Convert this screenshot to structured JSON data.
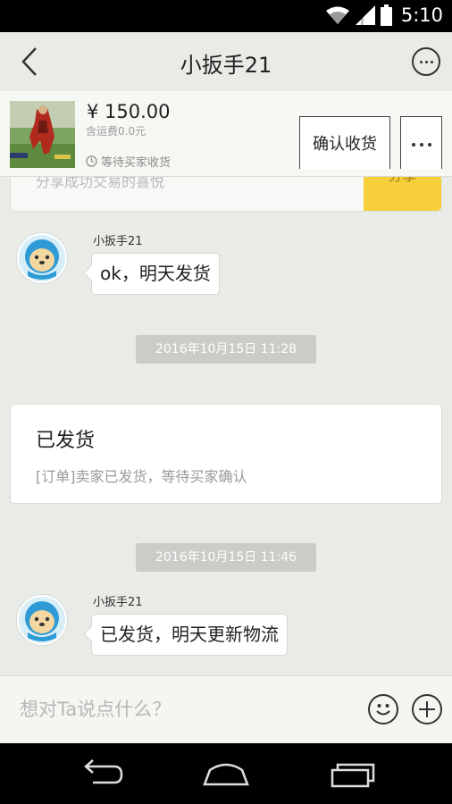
{
  "status_bar": {
    "time": "5:10",
    "icons": [
      "wifi-icon",
      "signal-icon",
      "battery-icon"
    ]
  },
  "header": {
    "title": "小扳手21",
    "back_icon": "back-arrow-icon",
    "more_icon": "more-circle-icon"
  },
  "product": {
    "price": "¥ 150.00",
    "shipping": "含运费0.0元",
    "status": "等待买家收货",
    "confirm_label": "确认收货",
    "more_icon": "more-dots-icon"
  },
  "chat": {
    "share_text": "分享成功交易的喜悦",
    "share_label": "分享",
    "messages": [
      {
        "sender": "小扳手21",
        "text": "ok，明天发货"
      },
      {
        "timestamp": "2016年10月15日 11:28"
      },
      {
        "notice_title": "已发货",
        "notice_desc": "[订单]卖家已发货，等待买家确认"
      },
      {
        "timestamp": "2016年10月15日 11:46"
      },
      {
        "sender": "小扳手21",
        "text": "已发货，明天更新物流"
      }
    ]
  },
  "input": {
    "placeholder": "想对Ta说点什么？",
    "emoji_icon": "smiley-icon",
    "plus_icon": "plus-circle-icon"
  },
  "colors": {
    "accent_yellow": "#f6cf3b",
    "background": "#e9ebe7",
    "timestamp_bg": "#c9ccc7"
  }
}
